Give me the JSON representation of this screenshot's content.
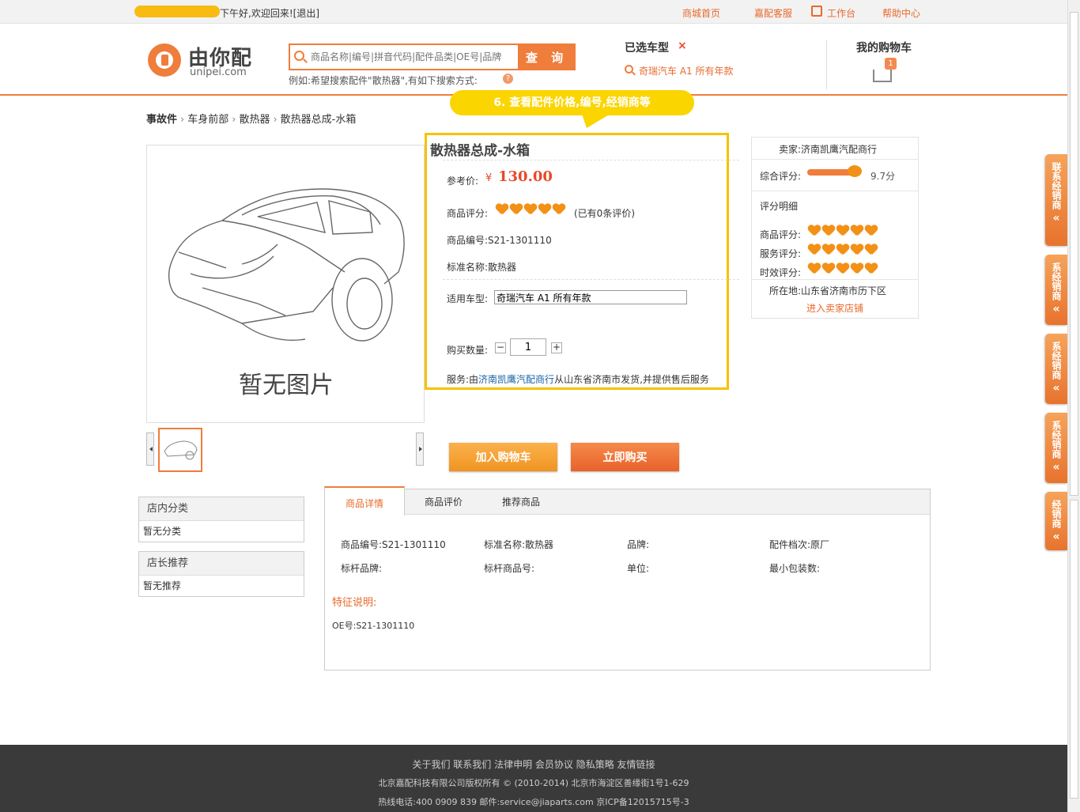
{
  "topbar": {
    "greeting": "下午好,欢迎回来!",
    "logout": "[退出]",
    "links": [
      {
        "label": "商城首页"
      },
      {
        "label": "嘉配客服"
      },
      {
        "label": "工作台"
      },
      {
        "label": "帮助中心"
      }
    ]
  },
  "header": {
    "logo_cn": "由你配",
    "logo_en": "unipei.com",
    "search_placeholder": "商品名称|编号|拼音代码|配件品类|OE号|品牌",
    "search_button": "查 询",
    "search_tip": "例如:希望搜索配件\"散热器\",有如下搜索方式:",
    "vehicle_title": "已选车型",
    "vehicle_name": "奇瑞汽车 A1 所有年款",
    "cart_title": "我的购物车",
    "cart_count": "1"
  },
  "annotation": "6. 查看配件价格,编号,经销商等",
  "breadcrumb": {
    "root": "事故件",
    "items": [
      "车身前部",
      "散热器",
      "散热器总成-水箱"
    ]
  },
  "product": {
    "no_image_text": "暂无图片",
    "title": "散热器总成-水箱",
    "price_label": "参考价:",
    "currency": "¥",
    "price": "130.00",
    "rating_label": "商品评分:",
    "rating": 5,
    "review_count": "(已有0条评价)",
    "part_no_label": "商品编号:S21-1301110",
    "std_name_label": "标准名称:散热器",
    "model_label": "适用车型:",
    "model_value": "奇瑞汽车 A1 所有年款",
    "qty_label": "购买数量:",
    "qty": "1",
    "service_prefix": "服务:由",
    "service_seller": "济南凯鹰汽配商行",
    "service_suffix": "从山东省济南市发货,并提供售后服务",
    "add_to_cart": "加入购物车",
    "buy_now": "立即购买"
  },
  "seller": {
    "name": "卖家:济南凯鹰汽配商行",
    "overall_label": "综合评分:",
    "overall_score": "9.7分",
    "detail_label": "评分明细",
    "goods_label": "商品评分:",
    "service_label": "服务评分:",
    "timeliness_label": "时效评分:",
    "goods_rating": 5,
    "service_rating": 5,
    "timeliness_rating": 5,
    "location": "所在地:山东省济南市历下区",
    "shop_link": "进入卖家店铺"
  },
  "sidebar": {
    "category_title": "店内分类",
    "category_empty": "暂无分类",
    "recommend_title": "店长推荐",
    "recommend_empty": "暂无推荐"
  },
  "tabs": [
    {
      "label": "商品详情"
    },
    {
      "label": "商品评价"
    },
    {
      "label": "推荐商品"
    }
  ],
  "details": {
    "row1": [
      "商品编号:S21-1301110",
      "标准名称:散热器",
      "品牌:",
      "配件档次:原厂"
    ],
    "row2": [
      "标杆品牌:",
      "标杆商品号:",
      "单位:",
      "最小包装数:"
    ],
    "feature_title": "特征说明:",
    "oe": "OE号:S21-1301110"
  },
  "float_tabs": [
    "联系经销商",
    "系经销商",
    "系经销商",
    "系经销商",
    "经销商"
  ],
  "footer": {
    "links": "关于我们 联系我们 法律申明 会员协议 隐私策略 友情链接",
    "copyright": "北京嘉配科技有限公司版权所有 © (2010-2014) 北京市海淀区善缘街1号1-629",
    "contact": "热线电话:400 0909 839    邮件:service@jiaparts.com    京ICP备12015715号-3"
  },
  "colors": {
    "accent": "#ef7d3c",
    "highlight": "#f7c200",
    "price": "#e8492b"
  }
}
